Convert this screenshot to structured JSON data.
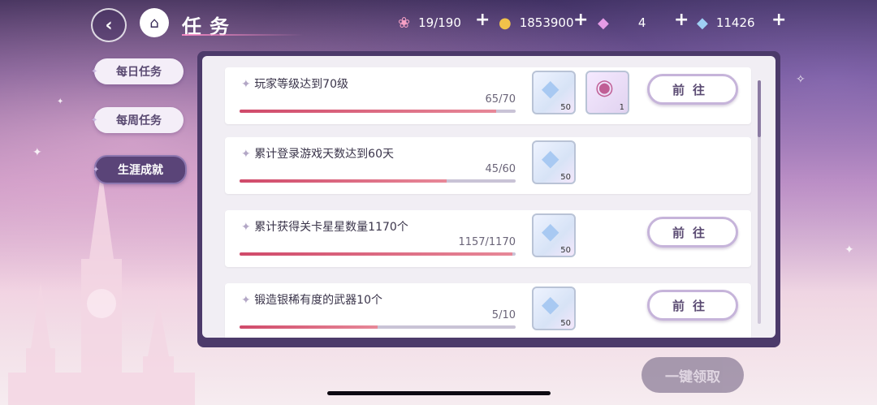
{
  "header": {
    "title": "任务",
    "resources": [
      {
        "icon": "candy-icon",
        "value": "19/190"
      },
      {
        "icon": "coin-icon",
        "value": "1853900"
      },
      {
        "icon": "pink-gem-icon",
        "value": "4"
      },
      {
        "icon": "diamond-icon",
        "value": "11426"
      }
    ]
  },
  "sidebar": {
    "tabs": [
      {
        "label": "每日任务",
        "active": false
      },
      {
        "label": "每周任务",
        "active": false
      },
      {
        "label": "生涯成就",
        "active": true
      }
    ]
  },
  "tasks": [
    {
      "name": "玩家等级达到70级",
      "progress": "65/70",
      "fraction": 0.9286,
      "rewards": [
        {
          "icon": "diamond-icon",
          "qty": "50"
        },
        {
          "icon": "crystal-orb-icon",
          "qty": "1"
        }
      ],
      "button": "前往"
    },
    {
      "name": "累计登录游戏天数达到60天",
      "progress": "45/60",
      "fraction": 0.75,
      "rewards": [
        {
          "icon": "diamond-icon",
          "qty": "50"
        }
      ],
      "button": ""
    },
    {
      "name": "累计获得关卡星星数量1170个",
      "progress": "1157/1170",
      "fraction": 0.989,
      "rewards": [
        {
          "icon": "diamond-icon",
          "qty": "50"
        }
      ],
      "button": "前往"
    },
    {
      "name": "锻造银稀有度的武器10个",
      "progress": "5/10",
      "fraction": 0.5,
      "rewards": [
        {
          "icon": "diamond-icon",
          "qty": "50"
        }
      ],
      "button": "前往"
    }
  ],
  "claim_all_label": "一键领取",
  "colors": {
    "accent": "#5a4478",
    "progress": "#d04a6a"
  }
}
